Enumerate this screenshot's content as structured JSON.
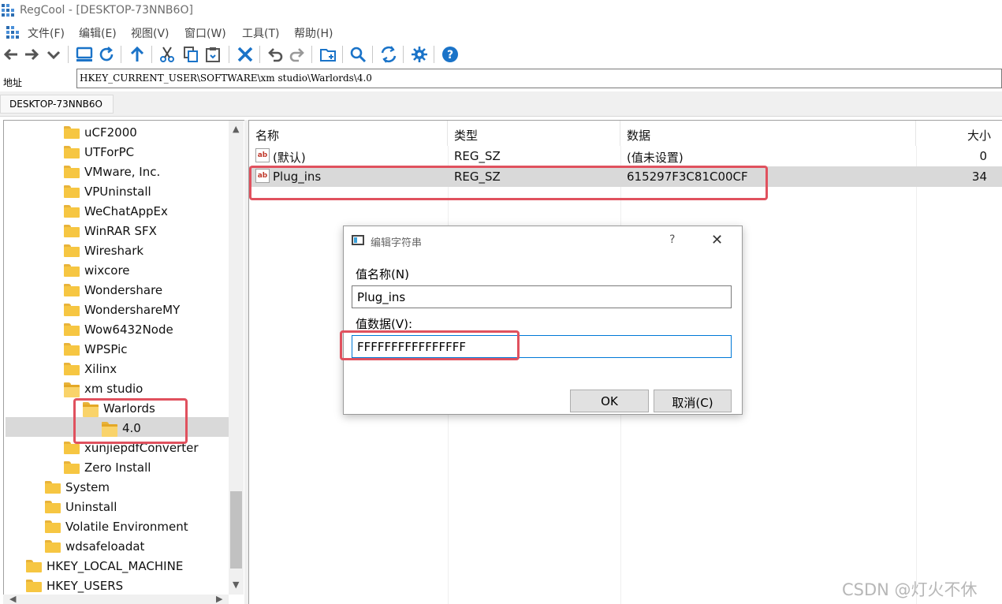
{
  "window": {
    "title": "RegCool - [DESKTOP-73NNB6O]"
  },
  "menu": [
    "文件(F)",
    "编辑(E)",
    "视图(V)",
    "窗口(W)",
    "工具(T)",
    "帮助(H)"
  ],
  "toolbar": {
    "icons": [
      "back-arrow-icon",
      "forward-arrow-icon",
      "dropdown-icon",
      "computer-icon",
      "refresh-icon",
      "up-arrow-icon",
      "cut-icon",
      "copy-icon",
      "paste-icon",
      "delete-icon",
      "undo-icon",
      "redo-icon",
      "new-key-icon",
      "search-icon",
      "compare-icon",
      "settings-icon",
      "help-icon"
    ]
  },
  "address": {
    "label": "地址",
    "value": "HKEY_CURRENT_USER\\SOFTWARE\\xm studio\\Warlords\\4.0"
  },
  "tab": {
    "label": "DESKTOP-73NNB6O"
  },
  "tree": {
    "items": [
      {
        "label": "uCF2000"
      },
      {
        "label": "UTForPC"
      },
      {
        "label": "VMware, Inc."
      },
      {
        "label": "VPUninstall"
      },
      {
        "label": "WeChatAppEx"
      },
      {
        "label": "WinRAR SFX"
      },
      {
        "label": "Wireshark"
      },
      {
        "label": "wixcore"
      },
      {
        "label": "Wondershare"
      },
      {
        "label": "WondershareMY"
      },
      {
        "label": "Wow6432Node"
      },
      {
        "label": "WPSPic"
      },
      {
        "label": "Xilinx"
      },
      {
        "label": "xm studio"
      },
      {
        "label": "Warlords"
      },
      {
        "label": "4.0"
      },
      {
        "label": "xunjiepdfConverter"
      },
      {
        "label": "Zero Install"
      },
      {
        "label": "System"
      },
      {
        "label": "Uninstall"
      },
      {
        "label": "Volatile Environment"
      },
      {
        "label": "wdsafeloadat"
      },
      {
        "label": "HKEY_LOCAL_MACHINE"
      },
      {
        "label": "HKEY_USERS"
      }
    ]
  },
  "list": {
    "columns": [
      "名称",
      "类型",
      "数据",
      "大小"
    ],
    "rows": [
      {
        "name": "(默认)",
        "type": "REG_SZ",
        "data": "(值未设置)",
        "size": "0",
        "icon": "ab"
      },
      {
        "name": "Plug_ins",
        "type": "REG_SZ",
        "data": "615297F3C81C00CF",
        "size": "34",
        "icon": "ab"
      }
    ]
  },
  "dialog": {
    "title": "编辑字符串",
    "help": "?",
    "close": "✕",
    "name_label": "值名称(N)",
    "name_value": "Plug_ins",
    "data_label": "值数据(V):",
    "data_value": "FFFFFFFFFFFFFFFF",
    "ok_label": "OK",
    "cancel_label": "取消(C)"
  },
  "watermark": "CSDN @灯火不休",
  "colors": {
    "highlight": "#e0515e",
    "folder": "#f6c642",
    "selection": "#d9d9d9",
    "accent": "#1a73c8"
  }
}
